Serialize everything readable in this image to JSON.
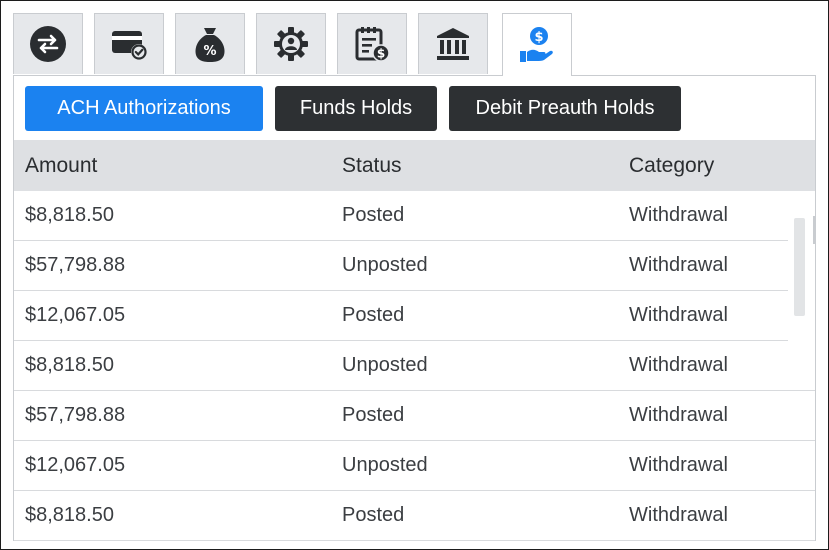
{
  "tabs": [
    {
      "icon": "transfer-icon"
    },
    {
      "icon": "card-check-icon"
    },
    {
      "icon": "money-bag-percent-icon"
    },
    {
      "icon": "gear-person-icon"
    },
    {
      "icon": "ledger-dollar-icon"
    },
    {
      "icon": "bank-icon"
    },
    {
      "icon": "hand-dollar-icon",
      "active": true
    }
  ],
  "subtabs": {
    "ach_label": "ACH Authorizations",
    "funds_label": "Funds Holds",
    "debit_label": "Debit Preauth Holds"
  },
  "table": {
    "columns": [
      "Amount",
      "Status",
      "Category"
    ],
    "rows": [
      [
        "$8,818.50",
        "Posted",
        "Withdrawal"
      ],
      [
        "$57,798.88",
        "Unposted",
        "Withdrawal"
      ],
      [
        "$12,067.05",
        "Posted",
        "Withdrawal"
      ],
      [
        "$8,818.50",
        "Unposted",
        "Withdrawal"
      ],
      [
        "$57,798.88",
        "Posted",
        "Withdrawal"
      ],
      [
        "$12,067.05",
        "Unposted",
        "Withdrawal"
      ],
      [
        "$8,818.50",
        "Posted",
        "Withdrawal"
      ]
    ]
  },
  "colors": {
    "primary": "#1b82f0",
    "dark_button": "#2d3033",
    "icon_dark": "#2a2d30",
    "icon_active": "#1b82f0"
  }
}
